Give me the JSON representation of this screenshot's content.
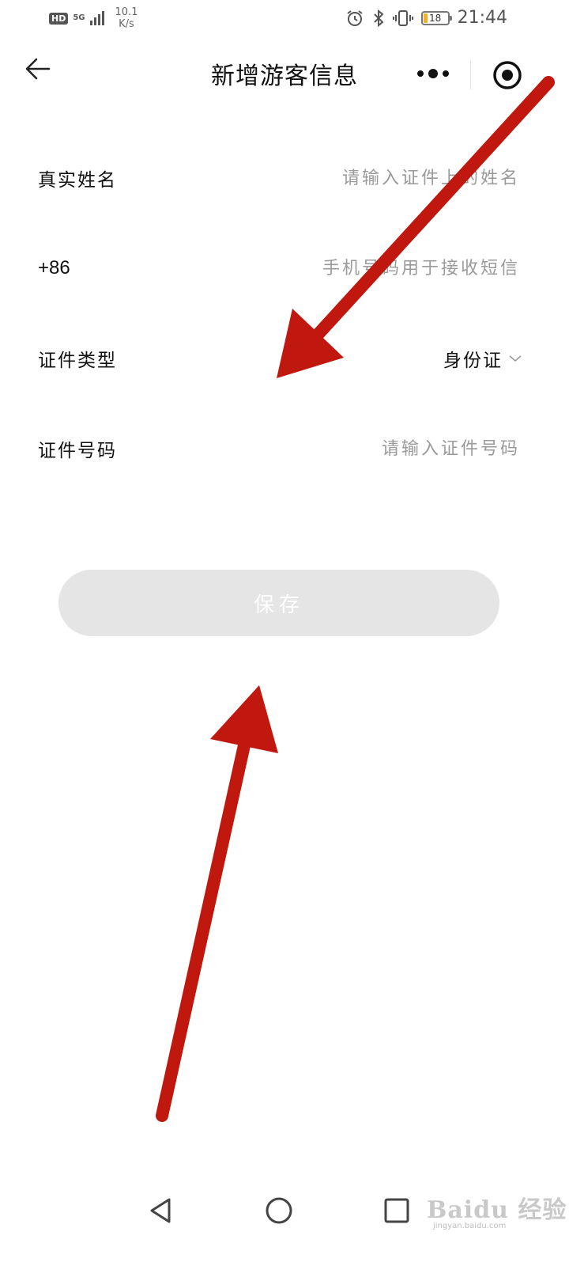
{
  "status_bar": {
    "hd": "HD",
    "network": "5G",
    "speed_value": "10.1",
    "speed_unit": "K/s",
    "battery": "18",
    "time": "21:44"
  },
  "header": {
    "title": "新增游客信息",
    "back_icon": "arrow-left-icon",
    "more_icon": "more-dots-icon",
    "close_icon": "target-icon"
  },
  "form": {
    "name": {
      "label": "真实姓名",
      "placeholder": "请输入证件上的姓名"
    },
    "phone": {
      "label": "+86",
      "placeholder": "手机号码用于接收短信"
    },
    "id_type": {
      "label": "证件类型",
      "value": "身份证"
    },
    "id_number": {
      "label": "证件号码",
      "placeholder": "请输入证件号码"
    }
  },
  "save_button": {
    "label": "保存"
  },
  "watermark": {
    "text": "Baidu 经验",
    "sub": "jingyan.baidu.com"
  },
  "colors": {
    "annotation_arrow": "#c0180e",
    "button_bg": "#e5e5e5",
    "placeholder": "#9a9a9a"
  }
}
